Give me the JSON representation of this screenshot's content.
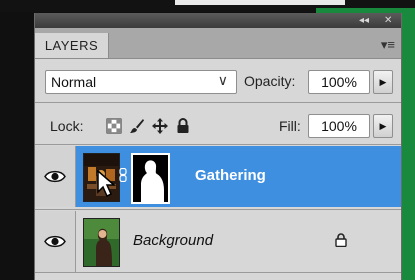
{
  "panel": {
    "tab_label": "LAYERS",
    "collapse_glyph": "◂◂",
    "close_glyph": "✕",
    "menu_glyph": "▾≡"
  },
  "controls": {
    "blend_mode": "Normal",
    "opacity_label": "Opacity:",
    "opacity_value": "100%",
    "lock_label": "Lock:",
    "fill_label": "Fill:",
    "fill_value": "100%"
  },
  "layers": [
    {
      "name": "Gathering",
      "selected": true,
      "has_mask": true,
      "locked": false
    },
    {
      "name": "Background",
      "selected": false,
      "has_mask": false,
      "locked": true
    }
  ],
  "colors": {
    "selected_row": "#3f8fe0",
    "panel_bg": "#d7d7d7",
    "accent_green": "#198a3d"
  }
}
